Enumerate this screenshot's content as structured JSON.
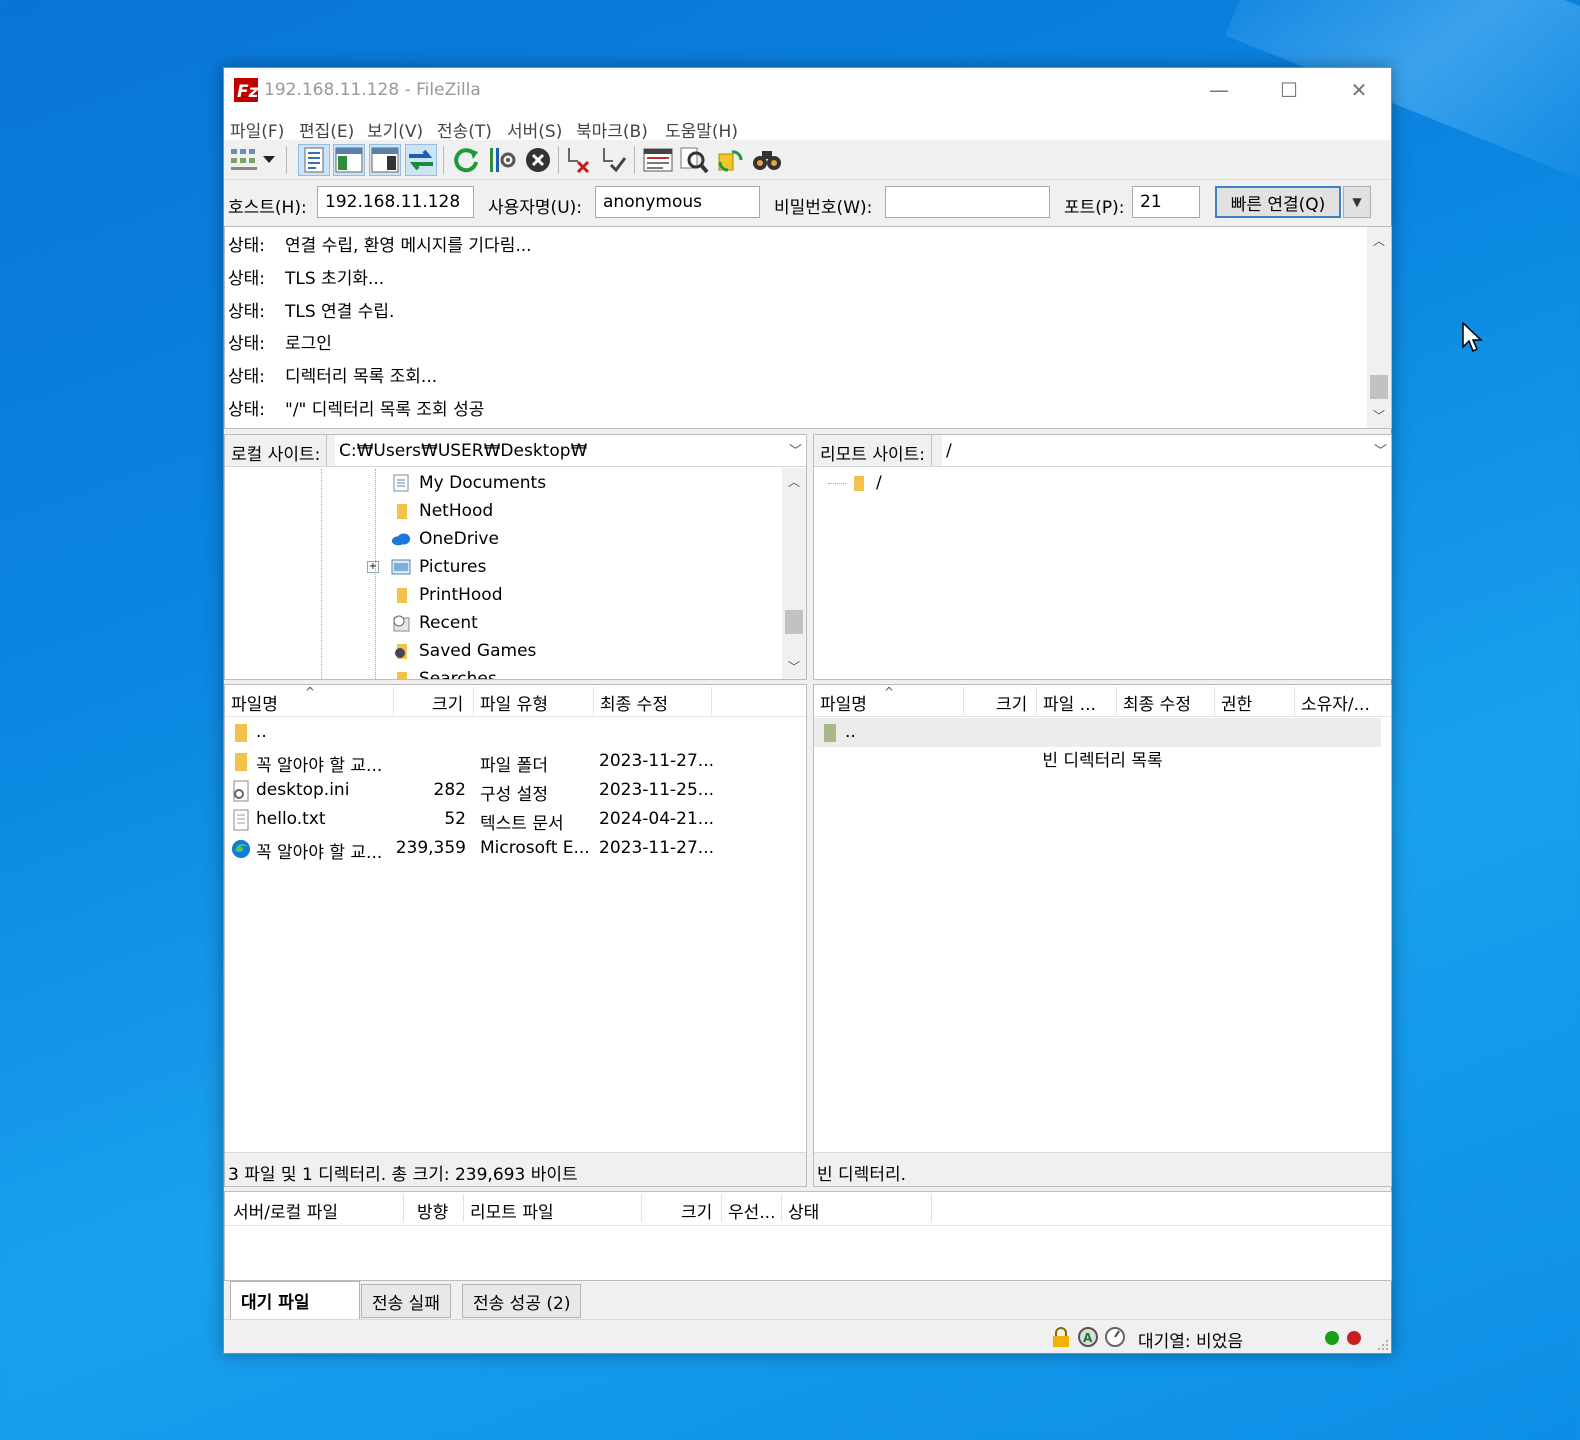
{
  "window": {
    "title": "192.168.11.128 - FileZilla",
    "minimize": "—",
    "maximize": "☐",
    "close": "✕"
  },
  "menu": [
    "파일(F)",
    "편집(E)",
    "보기(V)",
    "전송(T)",
    "서버(S)",
    "북마크(B)",
    "도움말(H)"
  ],
  "toolbar": {
    "icons": [
      "site-manager-icon",
      "dropdown-icon",
      "toggle-message-log-icon",
      "toggle-local-tree-icon",
      "toggle-remote-tree-icon",
      "toggle-transfer-queue-icon",
      "refresh-icon",
      "process-queue-icon",
      "cancel-icon",
      "disconnect-icon",
      "reconnect-icon",
      "directory-listing-filter-icon",
      "compare-directories-icon",
      "sync-browsing-icon",
      "search-remote-icon"
    ]
  },
  "quickconnect": {
    "host_label": "호스트(H):",
    "host_value": "192.168.11.128",
    "user_label": "사용자명(U):",
    "user_value": "anonymous",
    "pass_label": "비밀번호(W):",
    "pass_value": "",
    "port_label": "포트(P):",
    "port_value": "21",
    "connect_button": "빠른 연결(Q)",
    "dropdown": "▼"
  },
  "log": {
    "label": "상태:",
    "lines": [
      "연결 수립, 환영 메시지를 기다림...",
      "TLS 초기화...",
      "TLS 연결 수립.",
      "로그인",
      "디렉터리 목록 조회...",
      "\"/\" 디렉터리 목록 조회 성공"
    ]
  },
  "local": {
    "site_label": "로컬 사이트:",
    "path": "C:₩Users₩USER₩Desktop₩",
    "tree": [
      "My Documents",
      "NetHood",
      "OneDrive",
      "Pictures",
      "PrintHood",
      "Recent",
      "Saved Games",
      "Searches"
    ],
    "columns": [
      "파일명",
      "크기",
      "파일 유형",
      "최종 수정"
    ],
    "files": [
      {
        "name": "..",
        "size": "",
        "type": "",
        "modified": ""
      },
      {
        "name": "꼭 알아야 할 교...",
        "size": "",
        "type": "파일 폴더",
        "modified": "2023-11-27..."
      },
      {
        "name": "desktop.ini",
        "size": "282",
        "type": "구성 설정",
        "modified": "2023-11-25..."
      },
      {
        "name": "hello.txt",
        "size": "52",
        "type": "텍스트 문서",
        "modified": "2024-04-21..."
      },
      {
        "name": "꼭 알아야 할 교...",
        "size": "239,359",
        "type": "Microsoft E...",
        "modified": "2023-11-27..."
      }
    ],
    "status": "3 파일 및 1 디렉터리. 총 크기: 239,693 바이트"
  },
  "remote": {
    "site_label": "리모트 사이트:",
    "path": "/",
    "tree": [
      "/"
    ],
    "columns": [
      "파일명",
      "크기",
      "파일 ...",
      "최종 수정",
      "권한",
      "소유자/..."
    ],
    "files": [
      {
        "name": ".."
      }
    ],
    "empty_message": "빈 디렉터리 목록",
    "status": "빈 디렉터리."
  },
  "queue": {
    "columns": [
      "서버/로컬 파일",
      "방향",
      "리모트 파일",
      "크기",
      "우선...",
      "상태"
    ],
    "tabs": [
      "대기 파일",
      "전송 실패",
      "전송 성공 (2)"
    ]
  },
  "statusbar": {
    "queue_text": "대기열: 비었음",
    "colors": {
      "led_green": "#1a9e1a",
      "led_red": "#c81e1e"
    }
  }
}
